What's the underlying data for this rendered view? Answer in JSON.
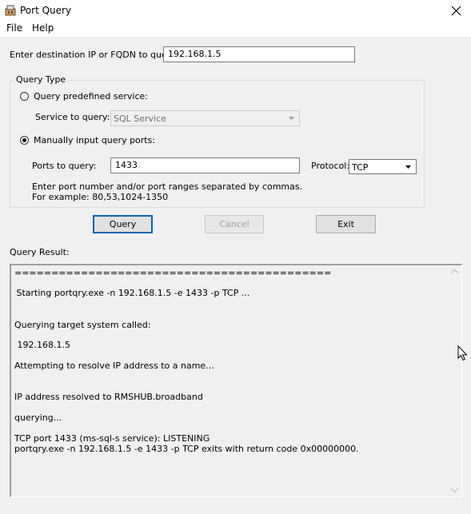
{
  "window": {
    "title": "Port Query"
  },
  "menu": [
    {
      "label": "File"
    },
    {
      "label": "Help"
    }
  ],
  "destination": {
    "label": "Enter destination IP or FQDN to query:",
    "value": "192.168.1.5"
  },
  "query_type": {
    "legend": "Query Type",
    "predefined_label": "Query predefined service:",
    "predefined_selected": false,
    "service_label": "Service to query:",
    "service_value": "SQL Service",
    "manual_label": "Manually input query ports:",
    "manual_selected": true,
    "ports_label": "Ports to query:",
    "ports_value": "1433",
    "protocol_label": "Protocol:",
    "protocol_value": "TCP",
    "hint_line1": "Enter port number and/or port ranges separated by commas.",
    "hint_line2": "For example: 80,53,1024-1350"
  },
  "buttons": {
    "query": "Query",
    "cancel": "Cancel",
    "exit": "Exit"
  },
  "result": {
    "label": "Query Result:",
    "lines": [
      "===========================================",
      " Starting portqry.exe -n 192.168.1.5 -e 1433 -p TCP ...",
      "Querying target system called:",
      " 192.168.1.5",
      "Attempting to resolve IP address to a name...",
      "IP address resolved to RMSHUB.broadband",
      "querying...",
      "TCP port 1433 (ms-sql-s service): LISTENING",
      "portqry.exe -n 192.168.1.5 -e 1433 -p TCP exits with return code 0x00000000."
    ]
  },
  "colors": {
    "default_button_border": "#0a64b4",
    "window_bg": "#f0f0f0"
  },
  "icons": {
    "app": "port-query-app-icon",
    "close": "close-icon",
    "arrow": "chevron-down-icon"
  }
}
